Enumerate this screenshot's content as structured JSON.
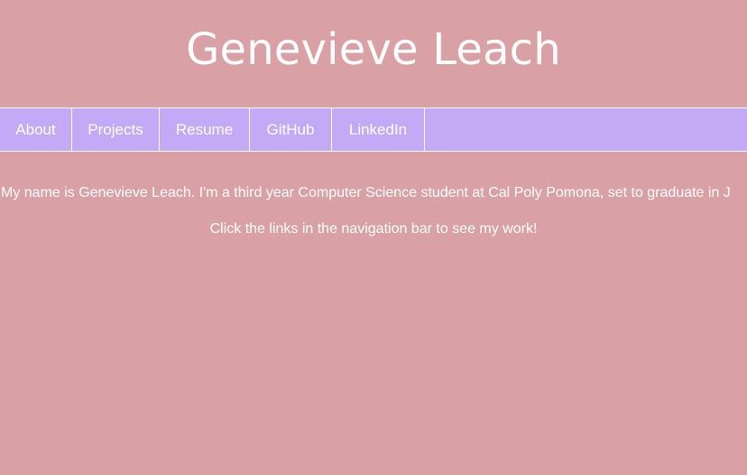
{
  "header": {
    "title": "Genevieve Leach"
  },
  "nav": {
    "items": [
      {
        "label": "About"
      },
      {
        "label": "Projects"
      },
      {
        "label": "Resume"
      },
      {
        "label": "GitHub"
      },
      {
        "label": "LinkedIn"
      }
    ]
  },
  "main": {
    "intro": "My name is Genevieve Leach. I'm a third year Computer Science student at Cal Poly Pomona, set to graduate in J",
    "cta": "Click the links in the navigation bar to see my work!"
  },
  "colors": {
    "page_background": "#d9a0a6",
    "nav_background": "#c4a9f6",
    "text": "#ffffff",
    "divider": "#ffffff"
  }
}
